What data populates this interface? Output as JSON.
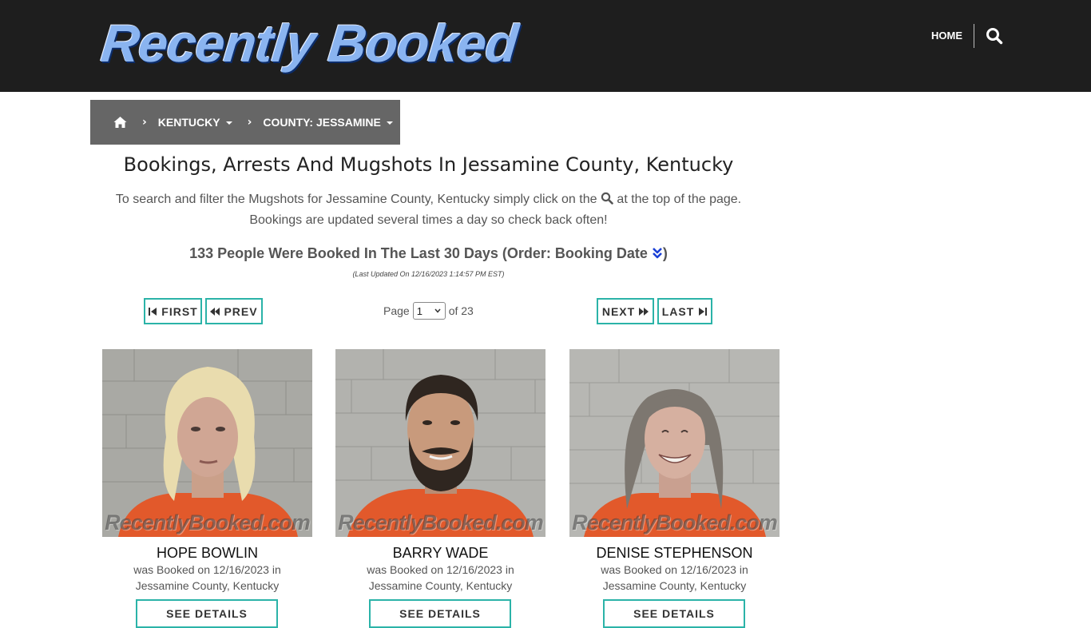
{
  "header": {
    "logo_text": "Recently Booked",
    "nav_home": "HOME",
    "search_icon": "search-icon"
  },
  "breadcrumb": {
    "home_icon": "home-icon",
    "items": [
      "KENTUCKY",
      "COUNTY: JESSAMINE"
    ]
  },
  "main": {
    "title": "Bookings, Arrests And Mugshots In Jessamine County, Kentucky",
    "intro_part1": "To search and filter the Mugshots for Jessamine County, Kentucky simply click on the",
    "intro_part2": "at the top of the page.",
    "intro_line2": "Bookings are updated several times a day so check back often!",
    "count_text": "133 People Were Booked In The Last 30 Days (Order: Booking Date",
    "count_close": ")",
    "last_updated": "(Last Updated On 12/16/2023 1:14:57 PM EST)"
  },
  "pager": {
    "first": "FIRST",
    "prev": "PREV",
    "page_label": "Page",
    "current_page": "1",
    "of_label": "of 23",
    "next": "NEXT",
    "last": "LAST"
  },
  "cards": [
    {
      "name": "HOPE BOWLIN",
      "line1": "was Booked on 12/16/2023 in",
      "line2": "Jessamine County, Kentucky",
      "watermark": "RecentlyBooked.com",
      "button": "SEE DETAILS"
    },
    {
      "name": "BARRY WADE",
      "line1": "was Booked on 12/16/2023 in",
      "line2": "Jessamine County, Kentucky",
      "watermark": "RecentlyBooked.com",
      "button": "SEE DETAILS"
    },
    {
      "name": "DENISE STEPHENSON",
      "line1": "was Booked on 12/16/2023 in",
      "line2": "Jessamine County, Kentucky",
      "watermark": "RecentlyBooked.com",
      "button": "SEE DETAILS"
    }
  ],
  "colors": {
    "header_bg": "#1e1e1e",
    "breadcrumb_bg": "#666666",
    "accent_teal": "#2bb3a8",
    "logo_blue": "#8ab4f0",
    "order_icon_blue": "#1a3fd6"
  }
}
